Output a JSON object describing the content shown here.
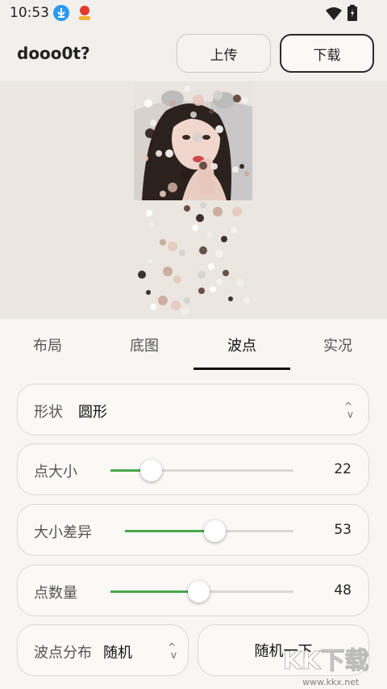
{
  "status": {
    "time": "10:53"
  },
  "app": {
    "title": "dooo0t?",
    "upload_label": "上传",
    "download_label": "下载"
  },
  "tabs": [
    {
      "label": "布局",
      "active": false
    },
    {
      "label": "底图",
      "active": false
    },
    {
      "label": "波点",
      "active": true
    },
    {
      "label": "实况",
      "active": false
    }
  ],
  "shape": {
    "label": "形状",
    "value": "圆形"
  },
  "dot_size": {
    "label": "点大小",
    "value": "22",
    "level": 0.22
  },
  "size_variance": {
    "label": "大小差异",
    "value": "53",
    "level": 0.53
  },
  "dot_count": {
    "label": "点数量",
    "value": "48",
    "level": 0.48
  },
  "distribution": {
    "label": "波点分布",
    "value": "随机"
  },
  "randomize": {
    "label": "随机一下"
  },
  "watermark": {
    "text": "KK下载",
    "url": "www.kkx.net"
  },
  "colors": {
    "accent": "#4aa84a",
    "panel": "#ebe6e0"
  }
}
